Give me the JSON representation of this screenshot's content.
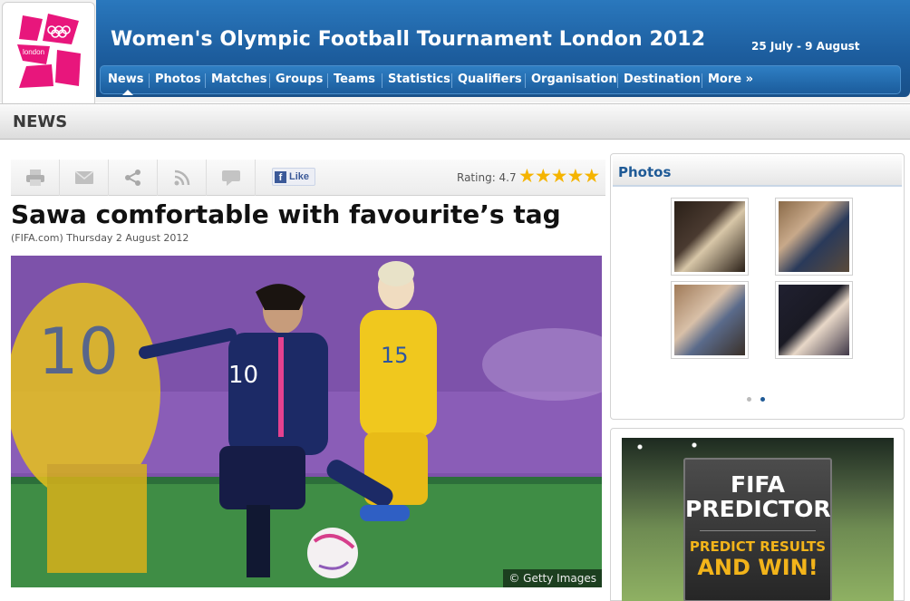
{
  "header": {
    "logo_text": "london",
    "title": "Women's Olympic Football Tournament London 2012",
    "dates": "25 July - 9 August"
  },
  "nav": {
    "items": [
      {
        "label": "News",
        "active": true
      },
      {
        "label": "Photos"
      },
      {
        "label": "Matches"
      },
      {
        "label": "Groups"
      },
      {
        "label": "Teams"
      },
      {
        "label": "Statistics"
      },
      {
        "label": "Qualifiers"
      },
      {
        "label": "Organisation"
      },
      {
        "label": "Destination"
      },
      {
        "label": "More »"
      }
    ]
  },
  "section": {
    "title": "NEWS"
  },
  "toolbar": {
    "tools": [
      "print-icon",
      "email-icon",
      "share-icon",
      "rss-icon",
      "comment-icon"
    ],
    "fb_like_label": "Like",
    "rating_label": "Rating: 4.7",
    "rating_value": 4.7,
    "rating_max": 5
  },
  "article": {
    "headline": "Sawa comfortable with favourite’s tag",
    "byline": "(FIFA.com) Thursday 2 August 2012",
    "photo_credit": "© Getty Images"
  },
  "photos_panel": {
    "title": "Photos",
    "thumbnails": [
      "photo-thumbnail-1",
      "photo-thumbnail-2",
      "photo-thumbnail-3",
      "photo-thumbnail-4"
    ],
    "pages": 2,
    "active_page": 2
  },
  "predictor": {
    "line1": "FIFA",
    "line2": "PREDICTOR",
    "cta1": "PREDICT RESULTS",
    "cta2": "AND WIN!"
  },
  "colors": {
    "banner_blue": "#1d5e9f",
    "link_blue": "#1f5a96",
    "star_gold": "#f5b400",
    "london_pink": "#e8167c",
    "predictor_gold": "#f3b41a"
  }
}
